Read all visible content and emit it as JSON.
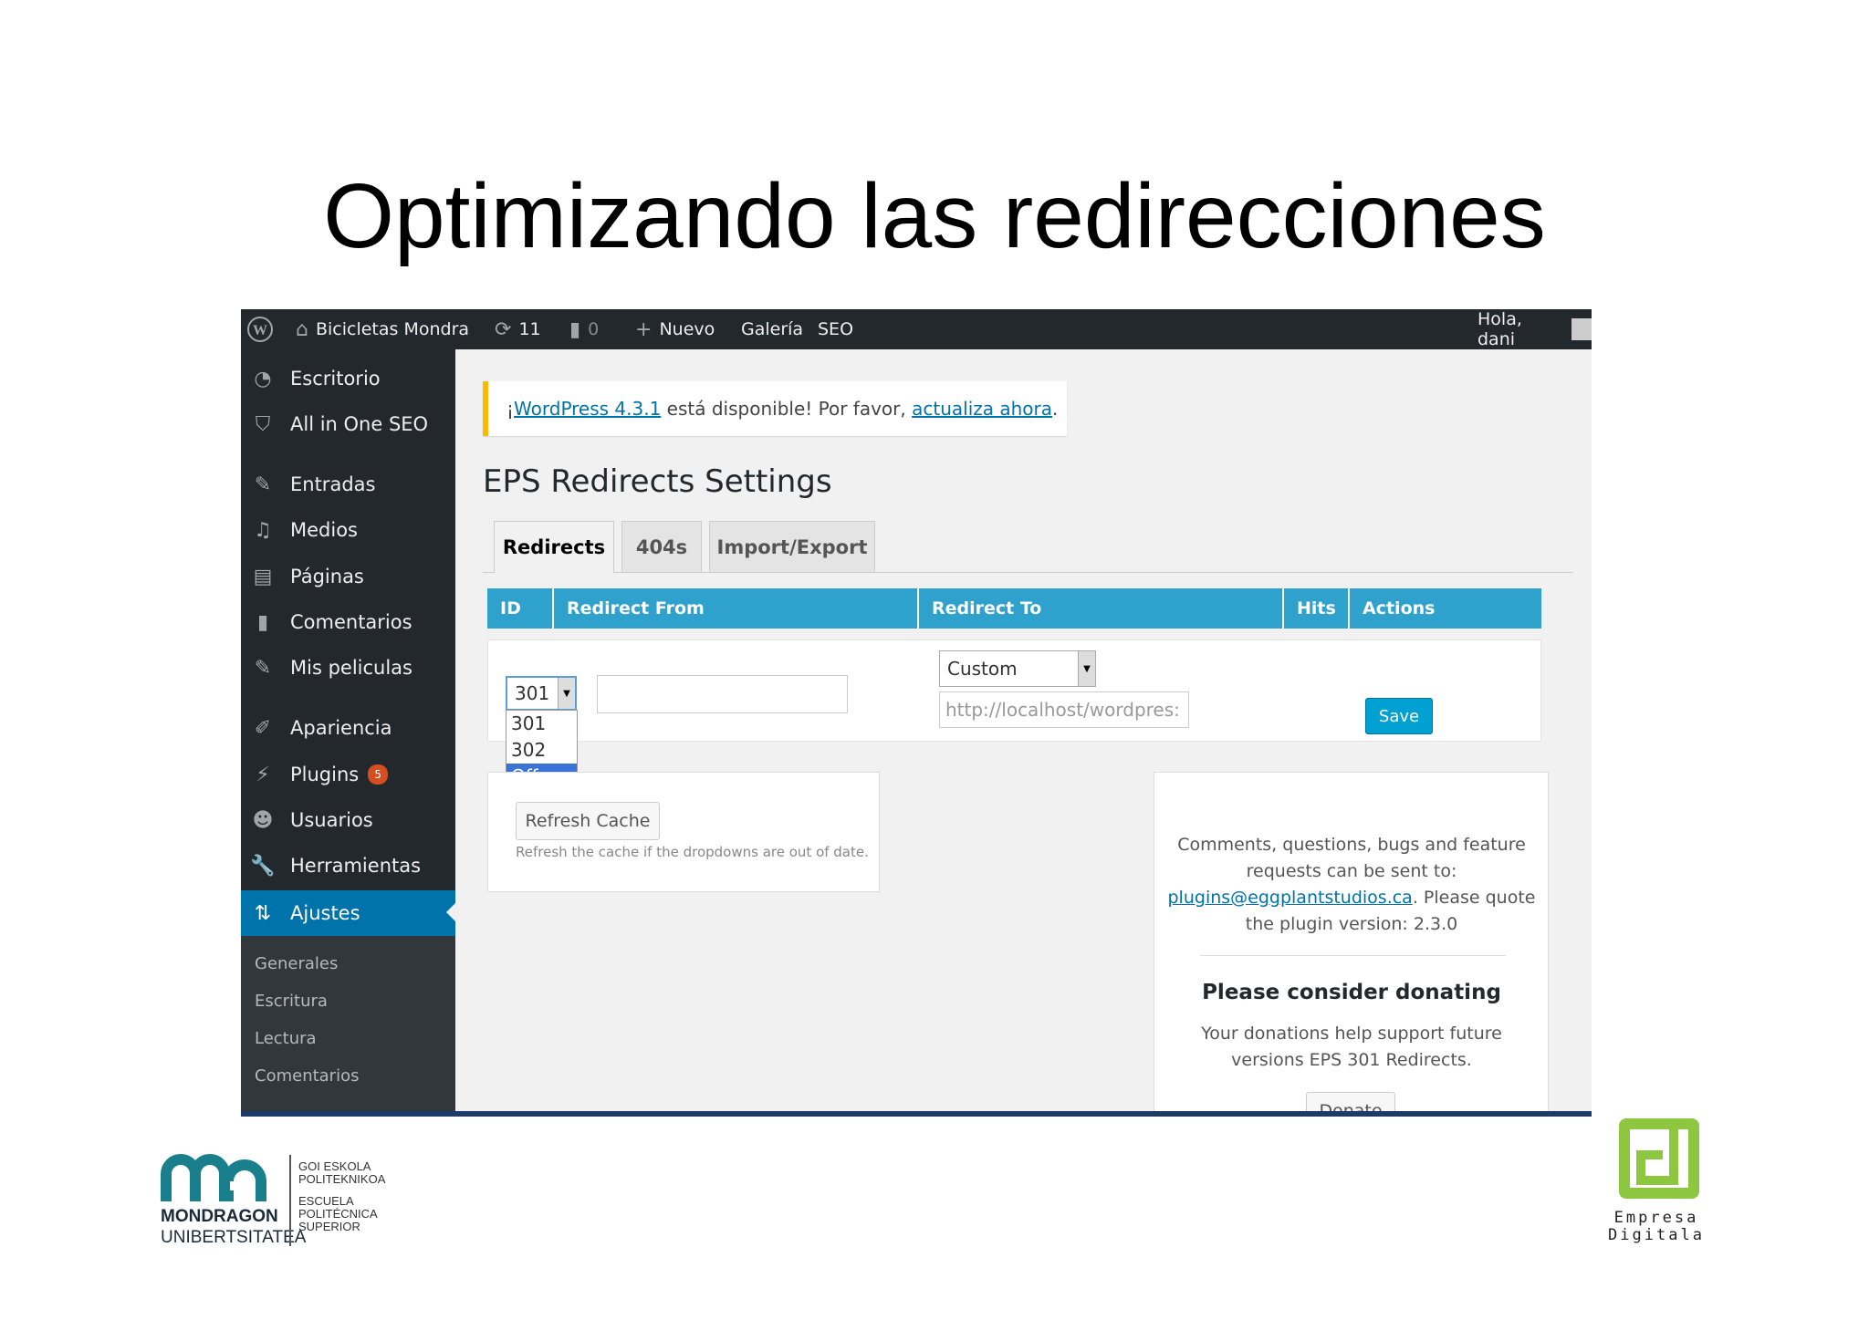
{
  "slide": {
    "title": "Optimizando las redirecciones"
  },
  "adminbar": {
    "site_name": "Bicicletas Mondra",
    "updates_count": "11",
    "comments_count": "0",
    "new_label": "Nuevo",
    "gallery_label": "Galería",
    "seo_label": "SEO",
    "greeting": "Hola, dani"
  },
  "sidebar": {
    "items": [
      {
        "label": "Escritorio",
        "icon": "dashboard-icon"
      },
      {
        "label": "All in One SEO",
        "icon": "shield-icon"
      },
      {
        "label": "Entradas",
        "icon": "pin-icon"
      },
      {
        "label": "Medios",
        "icon": "media-icon"
      },
      {
        "label": "Páginas",
        "icon": "pages-icon"
      },
      {
        "label": "Comentarios",
        "icon": "comment-icon"
      },
      {
        "label": "Mis peliculas",
        "icon": "pin-icon"
      },
      {
        "label": "Apariencia",
        "icon": "brush-icon"
      },
      {
        "label": "Plugins",
        "icon": "plugin-icon",
        "badge": "5"
      },
      {
        "label": "Usuarios",
        "icon": "users-icon"
      },
      {
        "label": "Herramientas",
        "icon": "wrench-icon"
      },
      {
        "label": "Ajustes",
        "icon": "settings-icon"
      }
    ],
    "submenu": [
      "Generales",
      "Escritura",
      "Lectura",
      "Comentarios"
    ]
  },
  "notice": {
    "prefix": "¡",
    "link1": "WordPress 4.3.1",
    "middle": " está disponible! Por favor, ",
    "link2": "actualiza ahora",
    "suffix": "."
  },
  "page_title": "EPS Redirects Settings",
  "tabs": [
    "Redirects",
    "404s",
    "Import/Export"
  ],
  "table": {
    "headers": [
      "ID",
      "Redirect From",
      "Redirect To",
      "Hits",
      "Actions"
    ],
    "status_select": "301",
    "status_options": [
      "301",
      "302",
      "Off"
    ],
    "redirect_from_value": "",
    "redirect_to_select": "Custom",
    "redirect_to_placeholder": "http://localhost/wordpres:",
    "save_label": "Save"
  },
  "cache": {
    "button": "Refresh Cache",
    "help": "Refresh the cache if the dropdowns are out of date."
  },
  "side_panel": {
    "text_before": "Comments, questions, bugs and feature requests can be sent to:",
    "email": "plugins@eggplantstudios.ca",
    "text_after": ". Please quote the plugin version: 2.3.0",
    "donate_heading": "Please consider donating",
    "donate_text": "Your donations help support future versions EPS 301 Redirects.",
    "donate_button": "Donate"
  },
  "footer": {
    "mu_name_line1": "MONDRAGON",
    "mu_name_line2": "UNIBERTSITATEA",
    "school_lines": [
      "GOI ESKOLA",
      "POLITEKNIKOA",
      "ESCUELA",
      "POLITÉCNICA",
      "SUPERIOR"
    ],
    "ed_line1": "Empresa",
    "ed_line2": "Digitala"
  }
}
